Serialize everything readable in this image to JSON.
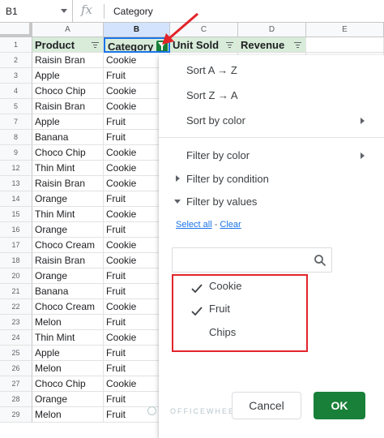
{
  "formula_bar": {
    "cell_ref": "B1",
    "fx": "fx",
    "value": "Category"
  },
  "columns": [
    "A",
    "B",
    "C",
    "D",
    "E"
  ],
  "header_row": {
    "num": "1",
    "cells": [
      "Product",
      "Category",
      "Unit Sold",
      "Revenue",
      ""
    ]
  },
  "rows": [
    {
      "num": "2",
      "product": "Raisin Bran",
      "category": "Cookie"
    },
    {
      "num": "3",
      "product": "Apple",
      "category": "Fruit"
    },
    {
      "num": "4",
      "product": "Choco Chip",
      "category": "Cookie"
    },
    {
      "num": "5",
      "product": "Raisin Bran",
      "category": "Cookie"
    },
    {
      "num": "7",
      "product": "Apple",
      "category": "Fruit"
    },
    {
      "num": "8",
      "product": "Banana",
      "category": "Fruit"
    },
    {
      "num": "9",
      "product": "Choco Chip",
      "category": "Cookie"
    },
    {
      "num": "12",
      "product": "Thin Mint",
      "category": "Cookie"
    },
    {
      "num": "13",
      "product": "Raisin Bran",
      "category": "Cookie"
    },
    {
      "num": "14",
      "product": "Orange",
      "category": "Fruit"
    },
    {
      "num": "15",
      "product": "Thin Mint",
      "category": "Cookie"
    },
    {
      "num": "16",
      "product": "Orange",
      "category": "Fruit"
    },
    {
      "num": "17",
      "product": "Choco Cream",
      "category": "Cookie"
    },
    {
      "num": "18",
      "product": "Raisin Bran",
      "category": "Cookie"
    },
    {
      "num": "20",
      "product": "Orange",
      "category": "Fruit"
    },
    {
      "num": "21",
      "product": "Banana",
      "category": "Fruit"
    },
    {
      "num": "22",
      "product": "Choco Cream",
      "category": "Cookie"
    },
    {
      "num": "23",
      "product": "Melon",
      "category": "Fruit"
    },
    {
      "num": "24",
      "product": "Thin Mint",
      "category": "Cookie"
    },
    {
      "num": "25",
      "product": "Apple",
      "category": "Fruit"
    },
    {
      "num": "26",
      "product": "Melon",
      "category": "Fruit"
    },
    {
      "num": "27",
      "product": "Choco Chip",
      "category": "Cookie"
    },
    {
      "num": "28",
      "product": "Orange",
      "category": "Fruit"
    },
    {
      "num": "29",
      "product": "Melon",
      "category": "Fruit"
    }
  ],
  "menu": {
    "sort_az": "Sort A → Z",
    "sort_za": "Sort Z → A",
    "sort_color": "Sort by color",
    "filter_color": "Filter by color",
    "filter_condition": "Filter by condition",
    "filter_values": "Filter by values",
    "select_all": "Select all",
    "dash": " - ",
    "clear": "Clear",
    "search_placeholder": "",
    "values": [
      {
        "label": "Cookie",
        "checked": true
      },
      {
        "label": "Fruit",
        "checked": true
      },
      {
        "label": "Chips",
        "checked": false
      }
    ],
    "cancel": "Cancel",
    "ok": "OK"
  },
  "watermark": "OFFICEWHEEL",
  "colors": {
    "header_fill": "#d8ecd9",
    "filter_green": "#188038",
    "highlight_red": "#e2242a",
    "link_blue": "#1a73e8"
  }
}
